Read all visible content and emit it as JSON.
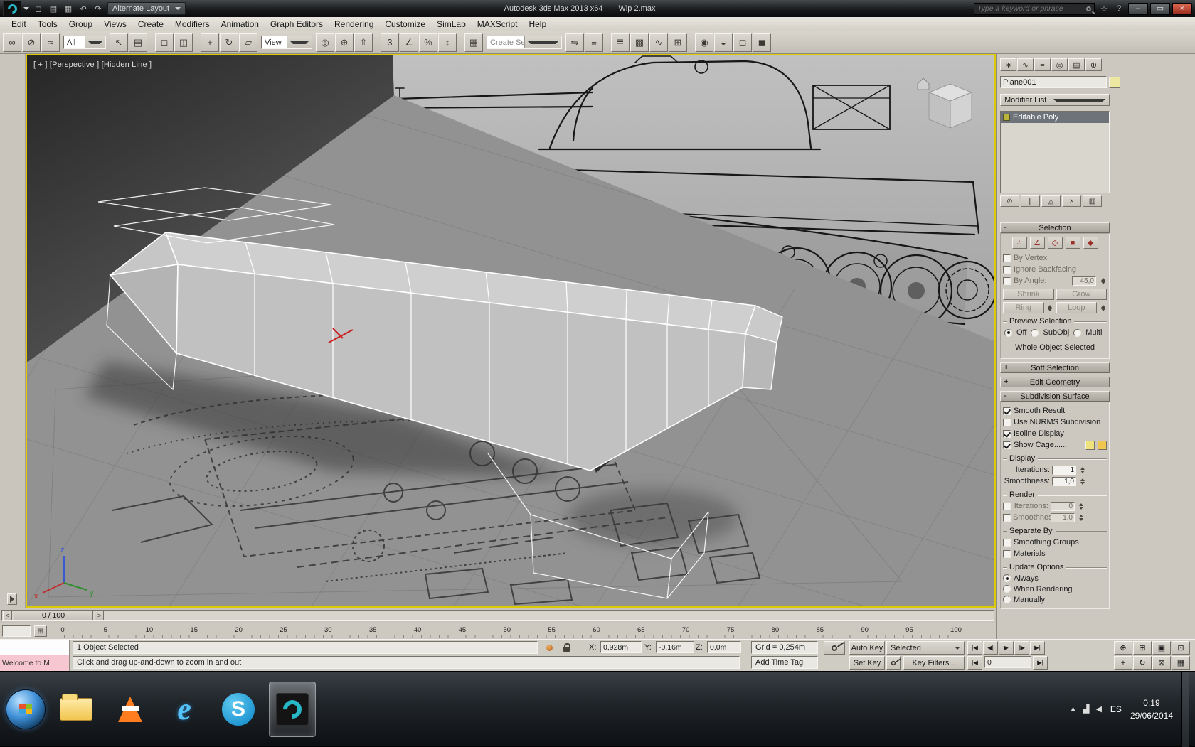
{
  "window": {
    "app_title": "Autodesk 3ds Max 2013 x64",
    "doc_title": "Wip 2.max",
    "layout_dropdown": "Alternate Layout",
    "search_placeholder": "Type a keyword or phrase",
    "min_glyph": "–",
    "restore_glyph": "▭",
    "close_glyph": "×",
    "quick_access": [
      {
        "name": "new-file-button",
        "glyph": "◻"
      },
      {
        "name": "open-file-button",
        "glyph": "▤"
      },
      {
        "name": "save-file-button",
        "glyph": "▦"
      },
      {
        "name": "undo-button",
        "glyph": "↶"
      },
      {
        "name": "redo-button",
        "glyph": "↷"
      }
    ],
    "info_icons": [
      {
        "name": "favorites-button",
        "glyph": "☆"
      },
      {
        "name": "help-button",
        "glyph": "?"
      }
    ]
  },
  "menubar": [
    "Edit",
    "Tools",
    "Group",
    "Views",
    "Create",
    "Modifiers",
    "Animation",
    "Graph Editors",
    "Rendering",
    "Customize",
    "SimLab",
    "MAXScript",
    "Help"
  ],
  "toolbar": {
    "filter_dropdown": "All",
    "coord_dropdown": "View",
    "sets_dropdown": "Create Selection Se",
    "g1": [
      {
        "name": "select-and-link-button",
        "glyph": "∞"
      },
      {
        "name": "unlink-selection-button",
        "glyph": "⊘"
      },
      {
        "name": "bind-to-space-warp-button",
        "glyph": "≈"
      }
    ],
    "g2": [
      {
        "name": "select-object-button",
        "glyph": "↖"
      },
      {
        "name": "select-by-name-button",
        "glyph": "▤"
      }
    ],
    "g3": [
      {
        "name": "rectangular-selection-region-button",
        "glyph": "◻"
      },
      {
        "name": "window-crossing-button",
        "glyph": "◫"
      }
    ],
    "g4": [
      {
        "name": "select-and-move-button",
        "glyph": "+"
      },
      {
        "name": "select-and-rotate-button",
        "glyph": "↻"
      },
      {
        "name": "select-and-scale-button",
        "glyph": "▱"
      }
    ],
    "g5": [
      {
        "name": "use-pivot-point-button",
        "glyph": "◎"
      },
      {
        "name": "select-and-manipulate-button",
        "glyph": "⊕"
      },
      {
        "name": "keyboard-override-button",
        "glyph": "⇧"
      }
    ],
    "g6": [
      {
        "name": "snaps-toggle-button",
        "glyph": "3"
      },
      {
        "name": "angle-snap-button",
        "glyph": "∠"
      },
      {
        "name": "percent-snap-button",
        "glyph": "%"
      },
      {
        "name": "spinner-snap-button",
        "glyph": "↕"
      }
    ],
    "g7": [
      {
        "name": "edit-named-selection-sets-button",
        "glyph": "▦"
      }
    ],
    "g8": [
      {
        "name": "mirror-button",
        "glyph": "⇋"
      },
      {
        "name": "align-button",
        "glyph": "≡"
      }
    ],
    "g9": [
      {
        "name": "layer-manager-button",
        "glyph": "≣"
      },
      {
        "name": "graphite-toggle-button",
        "glyph": "▩"
      },
      {
        "name": "curve-editor-button",
        "glyph": "∿"
      },
      {
        "name": "schematic-view-button",
        "glyph": "⊞"
      }
    ],
    "g10": [
      {
        "name": "material-editor-button",
        "glyph": "◉"
      },
      {
        "name": "render-setup-button",
        "glyph": "◒"
      },
      {
        "name": "rendered-frame-button",
        "glyph": "◻"
      },
      {
        "name": "render-production-button",
        "glyph": "◼"
      }
    ]
  },
  "viewport": {
    "label": "[ + ] [Perspective ] [Hidden Line ]",
    "axis": {
      "x": "x",
      "y": "y",
      "z": "z"
    }
  },
  "panel": {
    "object_name": "Plane001",
    "modifier_list": "Modifier List",
    "stack_item": "Editable Poly",
    "tabs": [
      {
        "name": "tab-create",
        "glyph": "∗"
      },
      {
        "name": "tab-modify",
        "glyph": "∿"
      },
      {
        "name": "tab-hierarchy",
        "glyph": "≡"
      },
      {
        "name": "tab-motion",
        "glyph": "◎"
      },
      {
        "name": "tab-display",
        "glyph": "▤"
      },
      {
        "name": "tab-utilities",
        "glyph": "⊕"
      }
    ],
    "stack_tools": [
      {
        "name": "pin-stack-button",
        "glyph": "⊙"
      },
      {
        "name": "show-end-result-button",
        "glyph": "∥"
      },
      {
        "name": "make-unique-button",
        "glyph": "◬"
      },
      {
        "name": "remove-modifier-button",
        "glyph": "×"
      },
      {
        "name": "configure-modifier-sets-button",
        "glyph": "▥"
      }
    ],
    "subobject_icons": [
      {
        "name": "vertex-mode-button",
        "glyph": "∴"
      },
      {
        "name": "edge-mode-button",
        "glyph": "∠"
      },
      {
        "name": "border-mode-button",
        "glyph": "◇"
      },
      {
        "name": "polygon-mode-button",
        "glyph": "■"
      },
      {
        "name": "element-mode-button",
        "glyph": "◆"
      }
    ],
    "rollouts": {
      "selection": {
        "label": "Selection",
        "sign": "-"
      },
      "soft": {
        "label": "Soft Selection",
        "sign": "+"
      },
      "editgeo": {
        "label": "Edit Geometry",
        "sign": "+"
      },
      "subdiv": {
        "label": "Subdivision Surface",
        "sign": "-"
      }
    },
    "selection": {
      "by_vertex": "By Vertex",
      "ignore_backfacing": "Ignore Backfacing",
      "by_angle": "By Angle:",
      "angle_value": "45,0",
      "shrink": "Shrink",
      "grow": "Grow",
      "ring": "Ring",
      "loop": "Loop",
      "preview": "Preview Selection",
      "off": "Off",
      "subobj": "SubObj",
      "multi": "Multi",
      "whole": "Whole Object Selected"
    },
    "subdiv": {
      "smooth_result": "Smooth Result",
      "use_nurms": "Use NURMS Subdivision",
      "isoline": "Isoline Display",
      "show_cage": "Show Cage......",
      "display_group": "Display",
      "render_group": "Render",
      "iterations": "Iterations:",
      "smoothness": "Smoothness:",
      "display_iterations": "1",
      "display_smoothness": "1,0",
      "render_iterations": "0",
      "render_smoothness": "1,0",
      "separate_by": "Separate By",
      "smoothing_groups": "Smoothing Groups",
      "materials": "Materials",
      "update_options": "Update Options",
      "always": "Always",
      "when_rendering": "When Rendering",
      "manually": "Manually"
    }
  },
  "timeline": {
    "prev": "<",
    "next": ">",
    "slider": "0 / 100",
    "ticks": [
      "0",
      "5",
      "10",
      "15",
      "20",
      "25",
      "30",
      "35",
      "40",
      "45",
      "50",
      "55",
      "60",
      "65",
      "70",
      "75",
      "80",
      "85",
      "90",
      "95",
      "100"
    ],
    "time_cfg_glyph": "⊞"
  },
  "status": {
    "selection_status": "1 Object Selected",
    "prompt": "Click and drag up-and-down to zoom in and out",
    "welcome": "Welcome to M",
    "x_label": "X:",
    "x_value": "0,928m",
    "y_label": "Y:",
    "y_value": "-0,16m",
    "z_label": "Z:",
    "z_value": "0,0m",
    "grid": "Grid = 0,254m",
    "add_time_tag": "Add Time Tag",
    "auto_key": "Auto Key",
    "set_key": "Set Key",
    "selected_set": "Selected",
    "key_filters": "Key Filters...",
    "frame": "0",
    "playback": [
      {
        "name": "go-to-start-button",
        "glyph": "|◀"
      },
      {
        "name": "previous-frame-button",
        "glyph": "◀|"
      },
      {
        "name": "play-button",
        "glyph": "▶"
      },
      {
        "name": "next-frame-button",
        "glyph": "|▶"
      },
      {
        "name": "go-to-end-button",
        "glyph": "▶|"
      }
    ],
    "prev_key_glyph": "|◀",
    "next_key_glyph": "▶|",
    "nav1": [
      {
        "name": "zoom-button",
        "glyph": "⊕"
      },
      {
        "name": "zoom-all-button",
        "glyph": "⊞"
      },
      {
        "name": "zoom-extents-button",
        "glyph": "▣"
      },
      {
        "name": "zoom-extents-all-button",
        "glyph": "⊡"
      }
    ],
    "nav2": [
      {
        "name": "pan-button",
        "glyph": "+"
      },
      {
        "name": "orbit-button",
        "glyph": "↻"
      },
      {
        "name": "maximize-viewport-button",
        "glyph": "⊠"
      },
      {
        "name": "field-of-view-button",
        "glyph": "▦"
      }
    ]
  },
  "taskbar": {
    "lang": "ES",
    "time": "0:19",
    "date": "29/06/2014",
    "ie_glyph": "e",
    "skype_glyph": "S",
    "tray_icons": [
      {
        "name": "hidden-icons-button",
        "glyph": "▲"
      },
      {
        "name": "network-icon",
        "glyph": "▟"
      },
      {
        "name": "volume-icon",
        "glyph": "◀"
      }
    ]
  }
}
